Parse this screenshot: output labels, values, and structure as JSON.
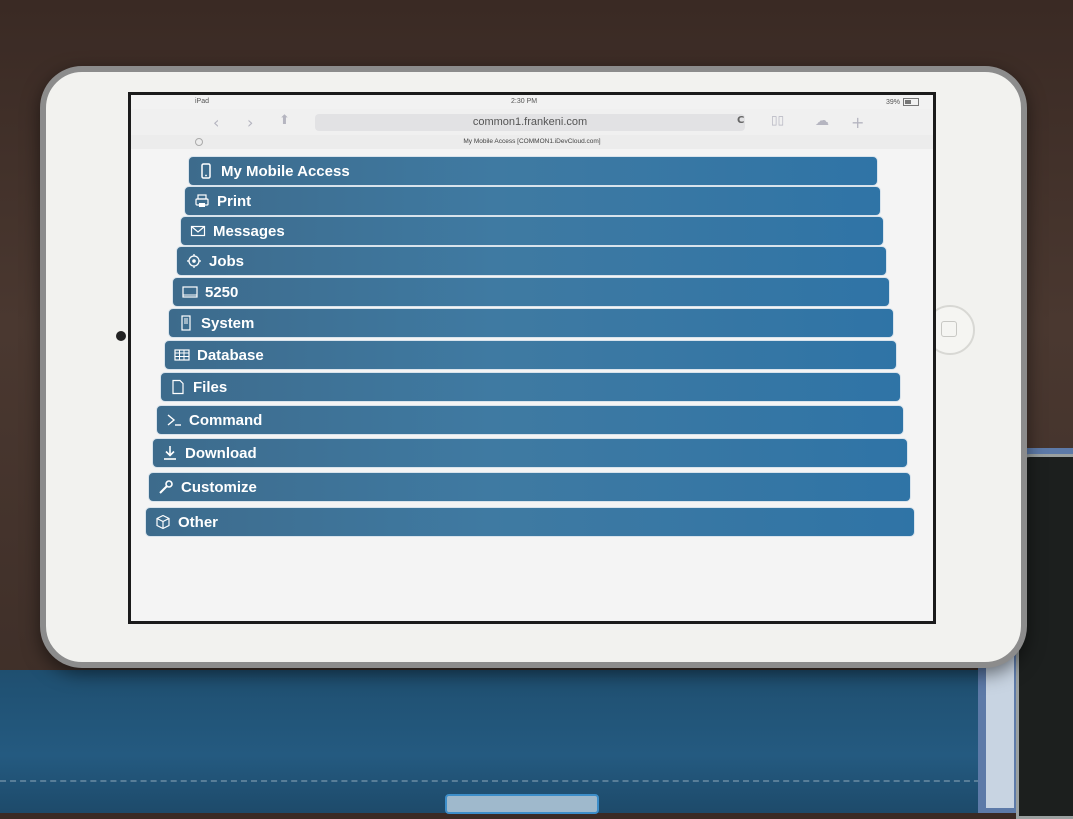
{
  "status_bar": {
    "device": "iPad",
    "time": "2:30 PM",
    "battery": "39%"
  },
  "browser": {
    "url": "common1.frankeni.com",
    "page_title": "My Mobile Access [COMMON1.iDevCloud.com]"
  },
  "menu": {
    "items": [
      {
        "label": "My Mobile Access",
        "icon": "mobile-phone-icon"
      },
      {
        "label": "Print",
        "icon": "printer-icon"
      },
      {
        "label": "Messages",
        "icon": "envelope-icon"
      },
      {
        "label": "Jobs",
        "icon": "gear-icon"
      },
      {
        "label": "5250",
        "icon": "terminal-screen-icon"
      },
      {
        "label": "System",
        "icon": "server-tower-icon"
      },
      {
        "label": "Database",
        "icon": "table-grid-icon"
      },
      {
        "label": "Files",
        "icon": "document-icon"
      },
      {
        "label": "Command",
        "icon": "command-prompt-icon"
      },
      {
        "label": "Download",
        "icon": "download-arrow-icon"
      },
      {
        "label": "Customize",
        "icon": "wrench-icon"
      },
      {
        "label": "Other",
        "icon": "cube-icon"
      }
    ]
  },
  "colors": {
    "menu_item_bg": "#3f7aa2",
    "menu_item_text": "#ffffff",
    "screen_bg": "#f4f4f4"
  }
}
